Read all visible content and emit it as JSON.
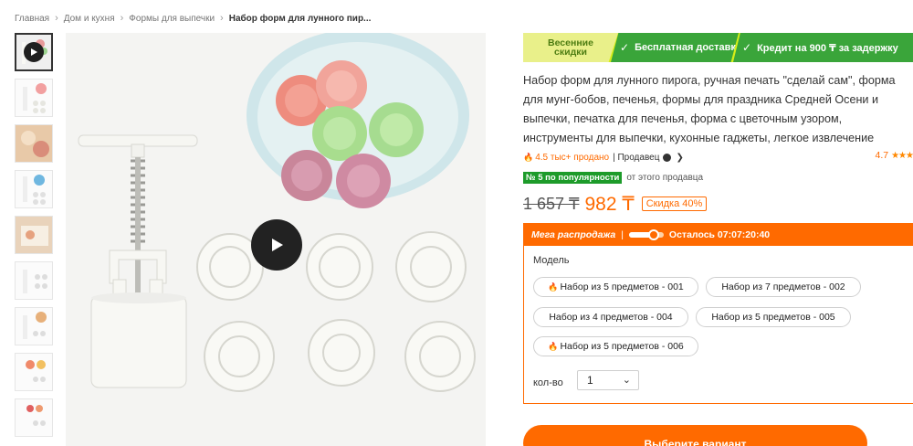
{
  "breadcrumb": {
    "items": [
      "Главная",
      "Дом и кухня",
      "Формы для выпечки"
    ],
    "current": "Набор форм для лунного пир...",
    "separator": "›"
  },
  "thumbnails": {
    "count": 10,
    "active_index": 0
  },
  "promo": {
    "badge_line1": "Весенние",
    "badge_line2": "скидки",
    "items": [
      "Бесплатная доставка",
      "Кредит на 900 ₸ за задержку"
    ],
    "check_icon": "✓"
  },
  "product": {
    "title": "Набор форм для лунного пирога, ручная печать \"сделай сам\", форма для мунг-бобов, печенья, формы для праздника Средней Осени и выпечки, печатка для печенья, форма с цветочным узором, инструменты для выпечки, кухонные гаджеты, легкое извлечение",
    "sold": "4.5 тыс+ продано",
    "seller_prefix": "| Продавец",
    "rating": "4.7",
    "popularity_badge": "№ 5 по популярности",
    "popularity_suffix": "от этого продавца"
  },
  "price": {
    "old": "1 657 ₸",
    "new": "982 ₸",
    "discount": "Скидка 40%"
  },
  "sale": {
    "name": "Мега распродажа",
    "separator": "|",
    "remaining_label": "Осталось 07:07:20:40",
    "timer_progress": 0.7
  },
  "options": {
    "model_label": "Модель",
    "variants": [
      {
        "label": "Набор из 5 предметов - 001",
        "hot": true
      },
      {
        "label": "Набор из 7 предметов - 002",
        "hot": false
      },
      {
        "label": "Набор из 4 предметов - 004",
        "hot": false
      },
      {
        "label": "Набор из 5 предметов - 005",
        "hot": false
      },
      {
        "label": "Набор из 5 предметов - 006",
        "hot": true
      }
    ],
    "qty_label": "кол-во",
    "qty_value": "1"
  },
  "cta": {
    "label": "Выберите вариант"
  },
  "colors": {
    "accent": "#ff6a00",
    "promo_green": "#3aa53a",
    "badge_green": "#1d9b2a"
  }
}
